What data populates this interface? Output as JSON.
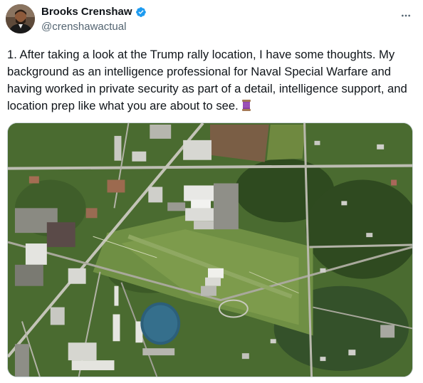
{
  "author": {
    "display_name": "Brooks Crenshaw",
    "handle": "@crenshawactual",
    "verified": true,
    "verified_color": "#1d9bf0",
    "avatar_icon": "profile-photo"
  },
  "actions": {
    "more_icon": "more-horizontal-icon"
  },
  "tweet": {
    "text": "1. After taking a look at the Trump rally location, I have some thoughts. My background as an intelligence professional for Naval Special Warfare and having worked in private security as part of a detail, intelligence support, and location prep like what you are about to see.",
    "emoji": "thread-spool"
  },
  "media": {
    "type": "aerial-satellite-photo",
    "subject": "rally location"
  }
}
